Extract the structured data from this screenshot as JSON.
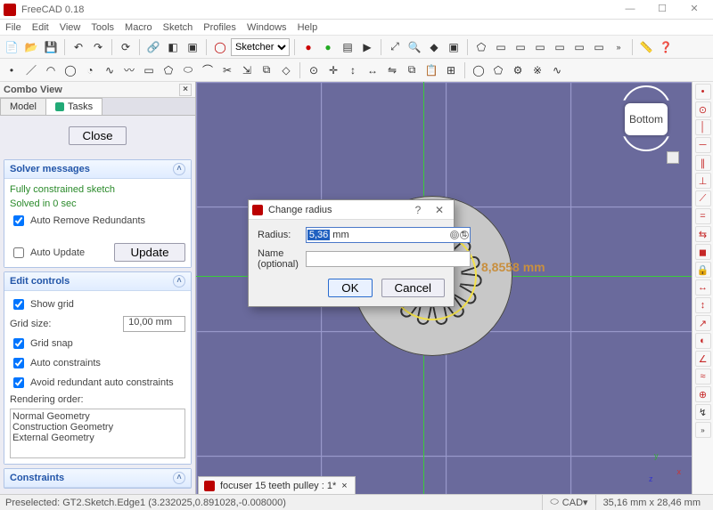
{
  "titlebar": {
    "title": "FreeCAD 0.18"
  },
  "win_buttons": {
    "min": "—",
    "max": "☐",
    "close": "✕"
  },
  "menu": [
    "File",
    "Edit",
    "View",
    "Tools",
    "Macro",
    "Sketch",
    "Profiles",
    "Windows",
    "Help"
  ],
  "toolbar1": {
    "workbench_select": "Sketcher"
  },
  "combo_view": {
    "header": "Combo View",
    "tabs": {
      "model": "Model",
      "tasks": "Tasks"
    },
    "close_btn": "Close",
    "solver": {
      "title": "Solver messages",
      "line1": "Fully constrained sketch",
      "line2": "Solved in 0 sec",
      "auto_remove": "Auto Remove Redundants",
      "auto_remove_checked": true,
      "auto_update": "Auto Update",
      "auto_update_checked": false,
      "update_btn": "Update"
    },
    "edit": {
      "title": "Edit controls",
      "show_grid": "Show grid",
      "show_grid_checked": true,
      "grid_size_label": "Grid size:",
      "grid_size_value": "10,00 mm",
      "grid_snap": "Grid snap",
      "grid_snap_checked": true,
      "auto_constraints": "Auto constraints",
      "auto_constraints_checked": true,
      "avoid_redundant": "Avoid redundant auto constraints",
      "avoid_redundant_checked": true,
      "render_label": "Rendering order:",
      "render_list": [
        "Normal Geometry",
        "Construction Geometry",
        "External Geometry"
      ]
    },
    "constraints": {
      "title": "Constraints"
    }
  },
  "viewport": {
    "navcube_face": "Bottom",
    "dimension_label": "8,8558 mm",
    "axes": {
      "x": "x",
      "y": "y",
      "z": "z"
    }
  },
  "dialog": {
    "title": "Change radius",
    "help": "?",
    "close": "✕",
    "radius_label": "Radius:",
    "radius_value": "5,36",
    "radius_unit": "mm",
    "name_label": "Name (optional)",
    "name_value": "",
    "ok": "OK",
    "cancel": "Cancel"
  },
  "file_tab": {
    "name": "focuser 15 teeth pulley : 1*",
    "close": "×"
  },
  "statusbar": {
    "preselected": "Preselected: GT2.Sketch.Edge1 (3.232025,0.891028,-0.008000)",
    "spacer": "",
    "cad": "CAD",
    "dims": "35,16 mm x 28,46 mm"
  }
}
